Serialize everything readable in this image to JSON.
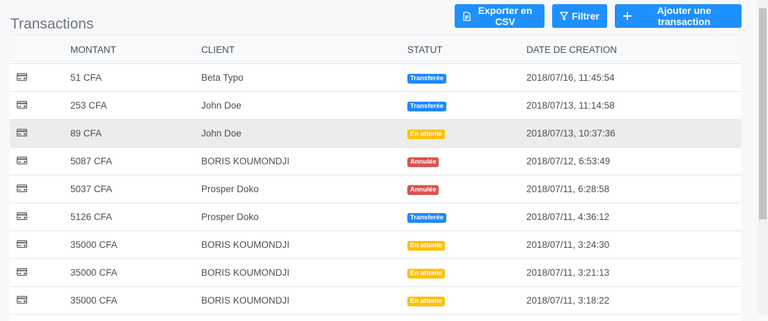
{
  "page": {
    "title": "Transactions"
  },
  "toolbar": {
    "export_label": "Exporter en CSV",
    "filter_label": "Filtrer",
    "add_label": "Ajouter une transaction"
  },
  "table": {
    "headers": {
      "montant": "MONTANT",
      "client": "CLIENT",
      "statut": "STATUT",
      "date": "DATE DE CREATION"
    },
    "rows": [
      {
        "amount": "51 CFA",
        "client": "Beta Typo",
        "status": "Transferée",
        "status_color": "#1e88ff",
        "date": "2018/07/16, 11:45:54"
      },
      {
        "amount": "253 CFA",
        "client": "John Doe",
        "status": "Transferée",
        "status_color": "#1e88ff",
        "date": "2018/07/13, 11:14:58"
      },
      {
        "amount": "89 CFA",
        "client": "John Doe",
        "status": "En attente",
        "status_color": "#ffc107",
        "date": "2018/07/13, 10:37:36"
      },
      {
        "amount": "5087 CFA",
        "client": "BORIS KOUMONDJI",
        "status": "Annulée",
        "status_color": "#d9534f",
        "date": "2018/07/12, 6:53:49"
      },
      {
        "amount": "5037 CFA",
        "client": "Prosper Doko",
        "status": "Annulée",
        "status_color": "#d9534f",
        "date": "2018/07/11, 6:28:58"
      },
      {
        "amount": "5126 CFA",
        "client": "Prosper Doko",
        "status": "Transferée",
        "status_color": "#1e88ff",
        "date": "2018/07/11, 4:36:12"
      },
      {
        "amount": "35000 CFA",
        "client": "BORIS KOUMONDJI",
        "status": "En attente",
        "status_color": "#ffc107",
        "date": "2018/07/11, 3:24:30"
      },
      {
        "amount": "35000 CFA",
        "client": "BORIS KOUMONDJI",
        "status": "En attente",
        "status_color": "#ffc107",
        "date": "2018/07/11, 3:21:13"
      },
      {
        "amount": "35000 CFA",
        "client": "BORIS KOUMONDJI",
        "status": "En attente",
        "status_color": "#ffc107",
        "date": "2018/07/11, 3:18:22"
      }
    ]
  },
  "colors": {
    "accent": "#1e90ff",
    "pending": "#ffc107",
    "cancelled": "#d9534f"
  },
  "icons": {
    "row": "credit-card-icon",
    "export": "file-icon",
    "filter": "filter-icon",
    "add": "plus-icon"
  }
}
